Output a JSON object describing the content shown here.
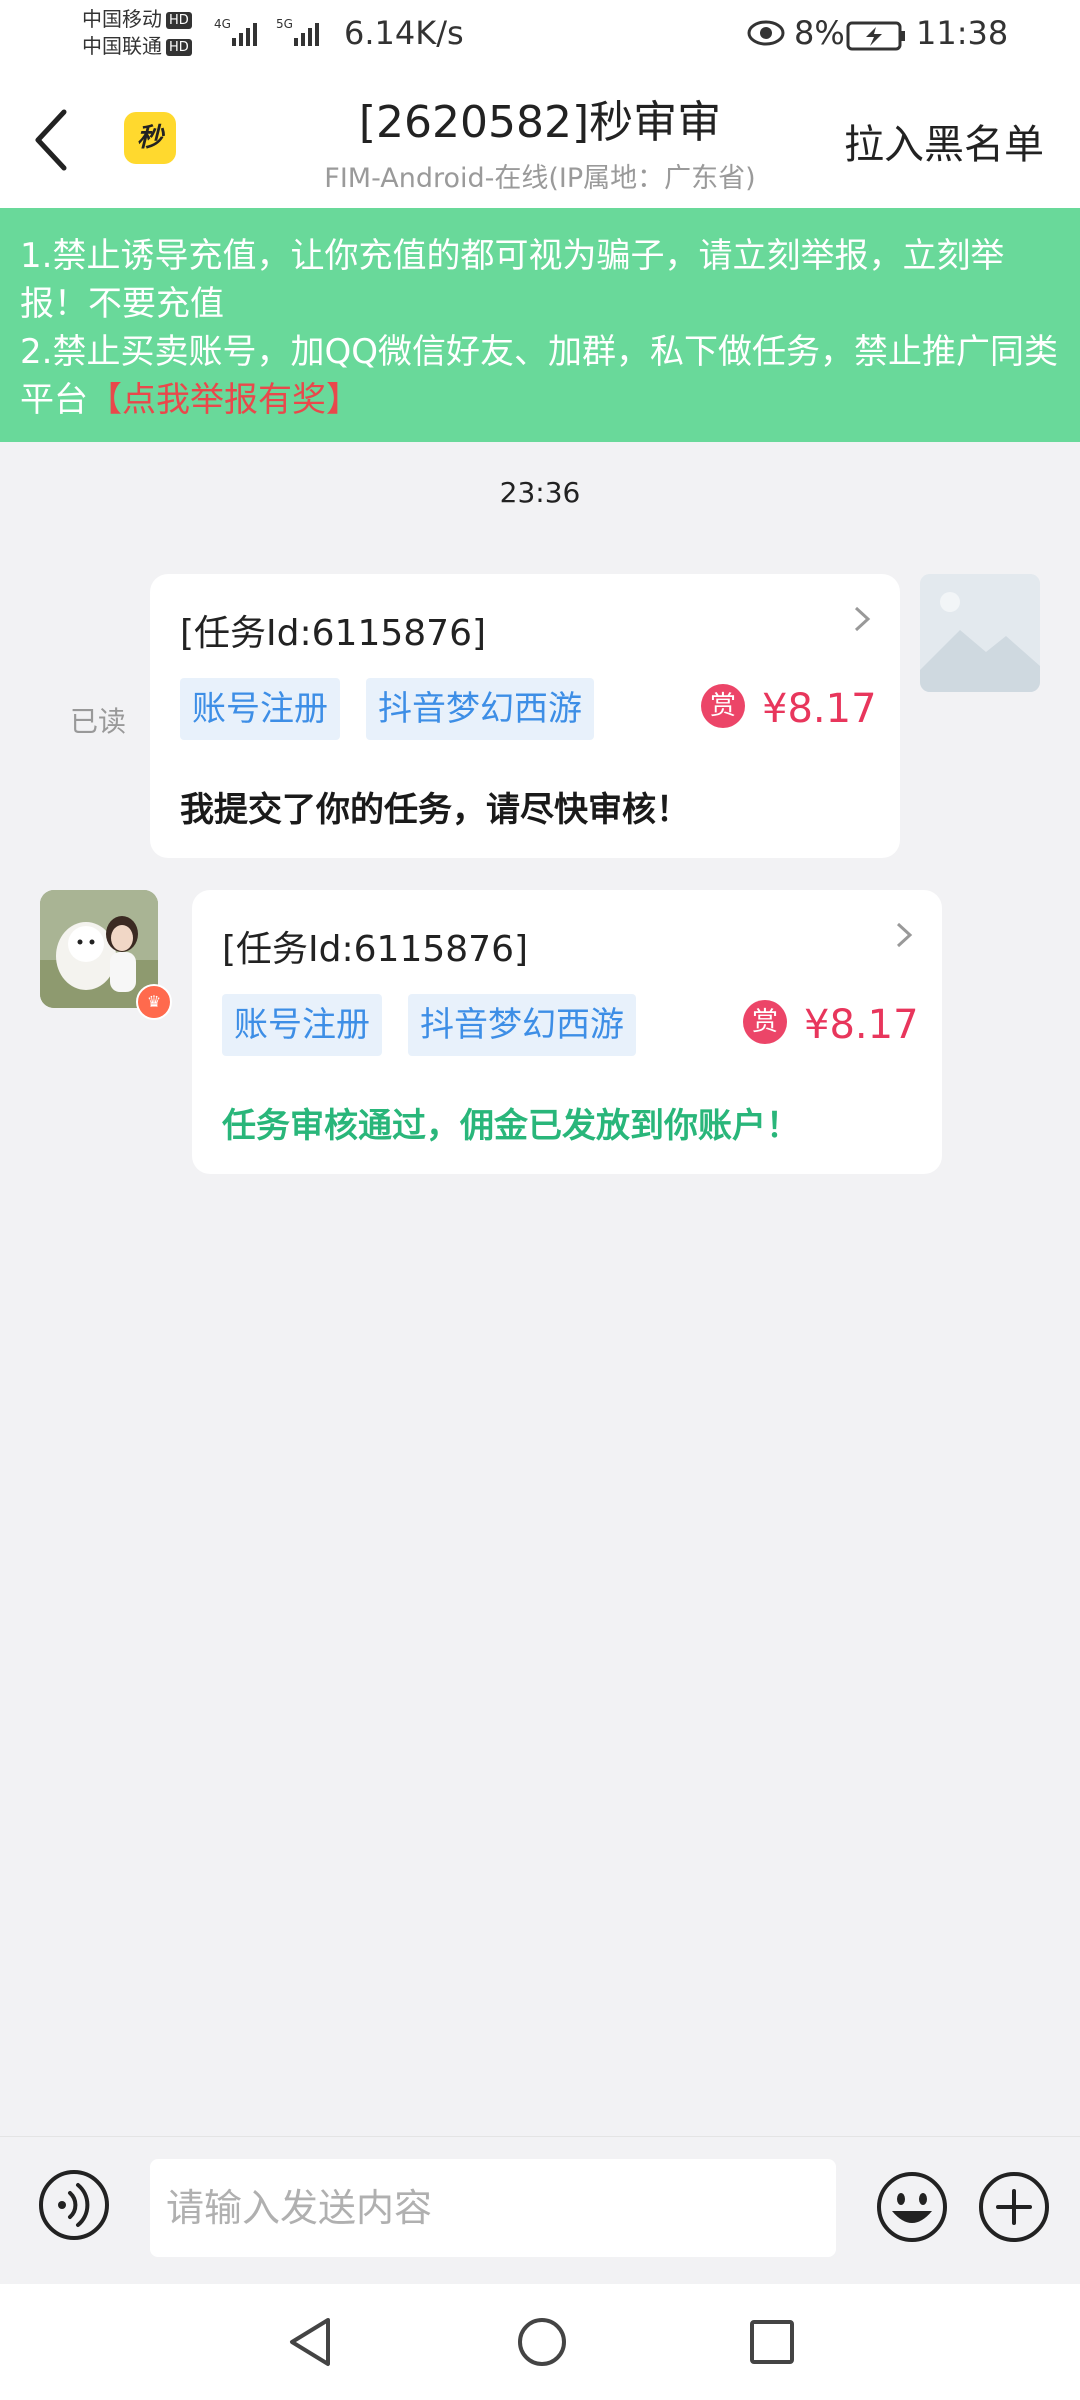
{
  "status_bar": {
    "carrier1": "中国移动",
    "carrier2": "中国联通",
    "hd_label": "HD",
    "net_speed": "6.14K/s",
    "battery_percent": "8%",
    "time": "11:38"
  },
  "header": {
    "app_logo_text": "秒",
    "title": "[2620582]秒审审",
    "subtitle": "FIM-Android-在线(IP属地：广东省)",
    "blacklist_label": "拉入黑名单"
  },
  "notice": {
    "line1": "1.禁止诱导充值，让你充值的都可视为骗子，请立刻举报，立刻举报！不要充值",
    "line2": "2.禁止买卖账号，加QQ微信好友、加群，私下做任务，禁止推广同类平台",
    "report_link": "【点我举报有奖】"
  },
  "chat": {
    "timestamp": "23:36",
    "read_status": "已读",
    "messages": [
      {
        "task_id": "[任务Id:6115876]",
        "tag1": "账号注册",
        "tag2": "抖音梦幻西游",
        "reward_badge": "赏",
        "reward": "¥8.17",
        "text": "我提交了你的任务，请尽快审核！"
      },
      {
        "task_id": "[任务Id:6115876]",
        "tag1": "账号注册",
        "tag2": "抖音梦幻西游",
        "reward_badge": "赏",
        "reward": "¥8.17",
        "text": "任务审核通过，佣金已发放到你账户！"
      }
    ]
  },
  "input": {
    "placeholder": "请输入发送内容"
  },
  "colors": {
    "notice_bg": "#69d99a",
    "reward": "#e8365c",
    "tag_text": "#3d8ee6",
    "approved_text": "#29b67a"
  }
}
